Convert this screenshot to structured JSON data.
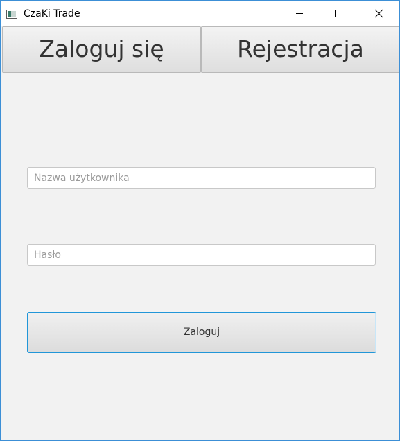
{
  "window": {
    "title": "CzaKi Trade",
    "icon": "java-window-icon",
    "controls": {
      "minimize": "minimize-icon",
      "maximize": "maximize-icon",
      "close": "close-icon"
    }
  },
  "tabs": [
    {
      "label": "Zaloguj się",
      "selected": true
    },
    {
      "label": "Rejestracja",
      "selected": false
    }
  ],
  "form": {
    "username": {
      "value": "",
      "placeholder": "Nazwa użytkownika"
    },
    "password": {
      "value": "",
      "placeholder": "Hasło"
    },
    "submit_label": "Zaloguj"
  },
  "colors": {
    "window_border": "#3c8fd6",
    "background": "#f2f2f2",
    "focus_accent": "#2196d8"
  }
}
